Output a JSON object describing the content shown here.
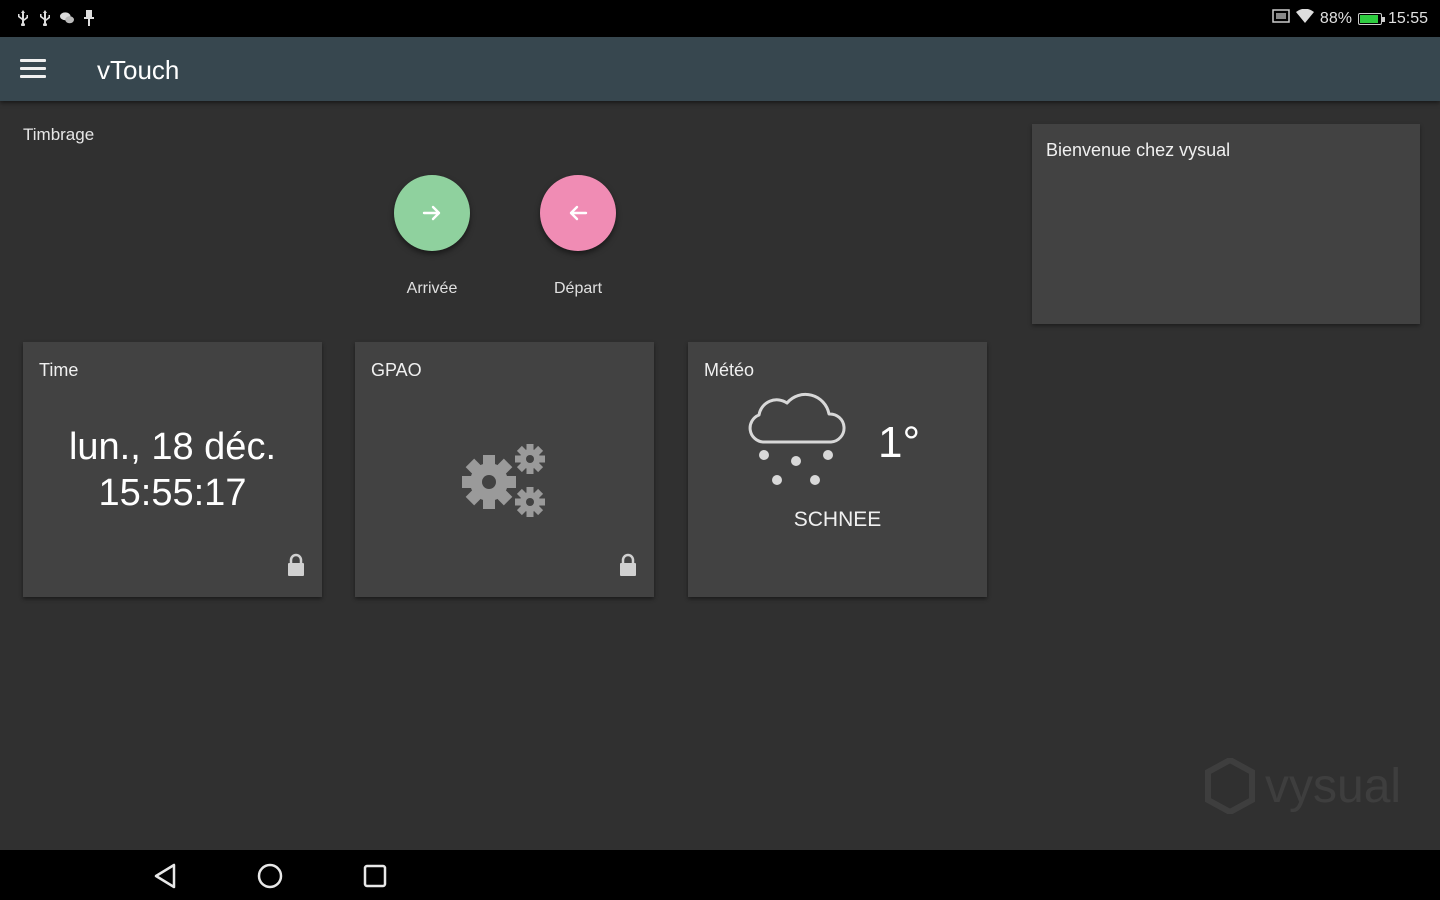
{
  "statusbar": {
    "battery_percent": "88%",
    "time": "15:55",
    "battery_level": 0.88,
    "battery_color": "#2ecc40",
    "left_icons": [
      "usb-icon",
      "usb-icon",
      "chat-icon",
      "pin-icon"
    ],
    "right_icons": [
      "screenshot-icon",
      "wifi-icon",
      "battery-icon"
    ]
  },
  "appbar": {
    "title": "vTouch",
    "background": "#37474f",
    "menu_icon": "hamburger-menu-icon"
  },
  "timbrage": {
    "label": "Timbrage",
    "arrival": {
      "label": "Arrivée",
      "color": "#8fd19e",
      "icon": "arrow-right-icon"
    },
    "departure": {
      "label": "Départ",
      "color": "#f08cb4",
      "icon": "arrow-left-icon"
    }
  },
  "welcome": {
    "text": "Bienvenue chez vysual"
  },
  "tiles": {
    "time": {
      "title": "Time",
      "date": "lun., 18 déc.",
      "clock": "15:55:17",
      "icon": "lock-icon"
    },
    "gpao": {
      "title": "GPAO",
      "icon": "gears-icon",
      "lock_icon": "lock-icon"
    },
    "meteo": {
      "title": "Météo",
      "temperature": "1°",
      "condition": "SCHNEE",
      "icon": "snow-cloud-icon"
    }
  },
  "watermark": {
    "text": "vysual"
  },
  "navbar": {
    "icons": [
      "back-icon",
      "home-icon",
      "recents-icon"
    ]
  }
}
